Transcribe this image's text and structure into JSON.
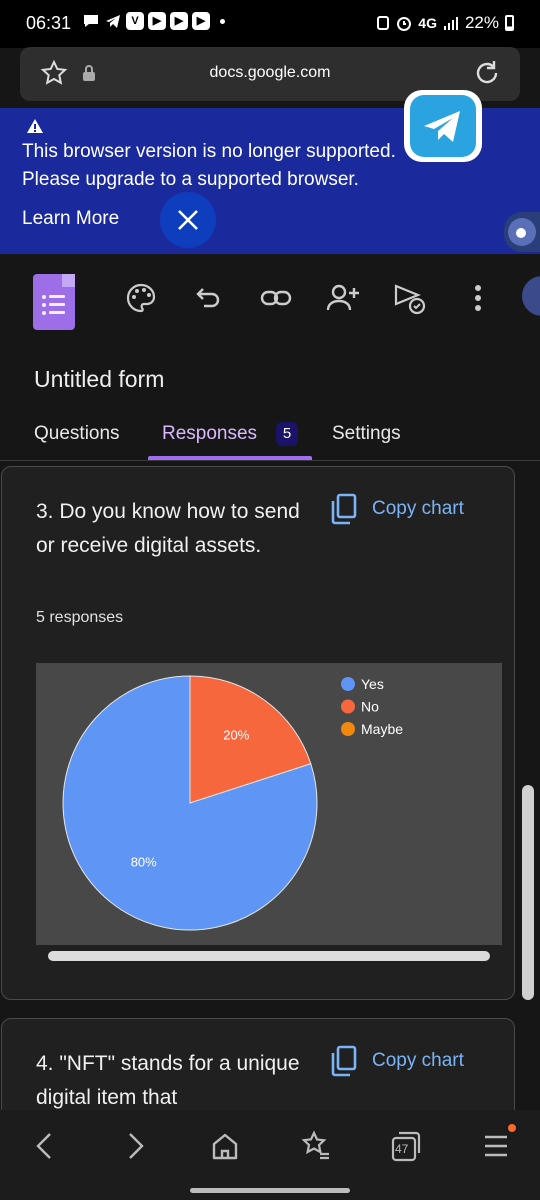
{
  "status_bar": {
    "time": "06:31",
    "network": "4G",
    "battery": "22%"
  },
  "browser": {
    "url": "docs.google.com"
  },
  "banner": {
    "message": "This browser version is no longer supported. Please upgrade to a supported browser.",
    "learn_more": "Learn More"
  },
  "form": {
    "title": "Untitled form",
    "tabs": [
      {
        "label": "Questions"
      },
      {
        "label": "Responses",
        "badge": "5"
      },
      {
        "label": "Settings"
      }
    ]
  },
  "cards": [
    {
      "question": "3. Do you know how to send or receive digital assets.",
      "copy_label": "Copy chart",
      "responses": "5 responses"
    },
    {
      "question": "4. \"NFT\" stands for a unique digital item that",
      "copy_label": "Copy chart"
    }
  ],
  "chart_data": {
    "type": "pie",
    "categories": [
      "Yes",
      "No",
      "Maybe"
    ],
    "values": [
      80,
      20,
      0
    ],
    "labels": [
      "80%",
      "20%",
      ""
    ],
    "colors": [
      "#5f95f5",
      "#f7673e",
      "#f0880e"
    ],
    "legend": "top-right"
  },
  "bottom_nav": {
    "tabs_count": "47"
  }
}
